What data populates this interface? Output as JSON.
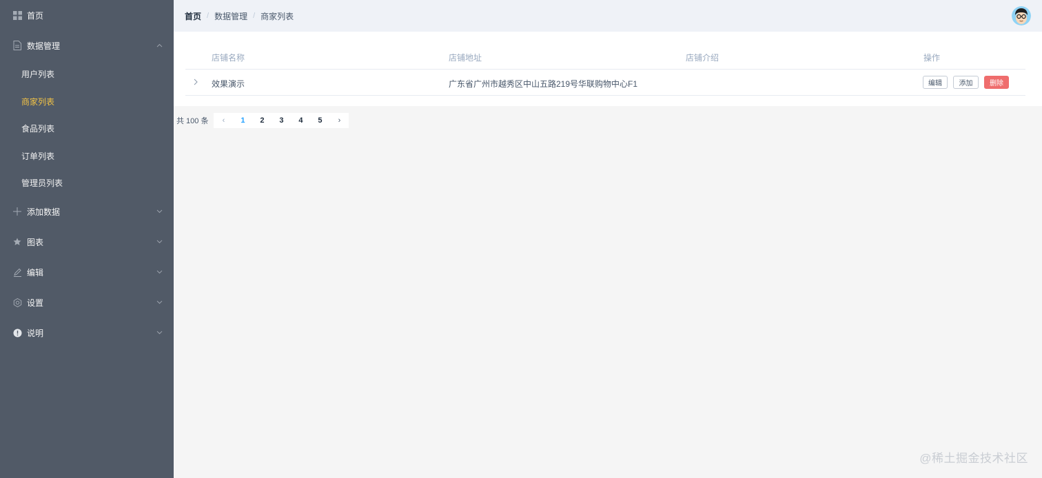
{
  "sidebar": {
    "home": "首页",
    "data_manage": {
      "label": "数据管理",
      "children": [
        "用户列表",
        "商家列表",
        "食品列表",
        "订单列表",
        "管理员列表"
      ]
    },
    "add_data": "添加数据",
    "charts": "图表",
    "edit": "编辑",
    "settings": "设置",
    "about": "说明",
    "colors": {
      "bg": "#515a67",
      "active": "#f0c146"
    }
  },
  "header": {
    "breadcrumb": [
      "首页",
      "数据管理",
      "商家列表"
    ],
    "separator": "/"
  },
  "table": {
    "columns": [
      "店铺名称",
      "店铺地址",
      "店铺介绍",
      "操作"
    ],
    "rows": [
      {
        "name": "效果演示",
        "address": "广东省广州市越秀区中山五路219号华联购物中心F1",
        "intro": ""
      }
    ],
    "actions": {
      "edit": "编辑",
      "add": "添加",
      "delete": "删除"
    },
    "colors": {
      "danger": "#ef6d6d"
    }
  },
  "pagination": {
    "total_text": "共 100 条",
    "pages": [
      "1",
      "2",
      "3",
      "4",
      "5"
    ],
    "current": "1",
    "prev_icon": "‹",
    "next_icon": "›",
    "colors": {
      "active": "#20a0ff"
    }
  },
  "watermark": "@稀土掘金技术社区"
}
